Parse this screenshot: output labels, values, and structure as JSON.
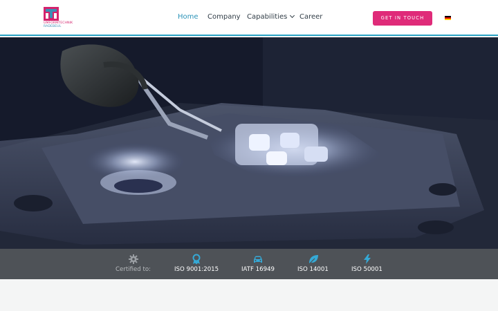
{
  "brand": {
    "name_line1": "UMFORMTECHNIK",
    "name_line2": "RADEBEUL",
    "primary_color": "#d4236d",
    "secondary_color": "#3b8fb5"
  },
  "nav": {
    "items": [
      {
        "label": "Home",
        "active": true
      },
      {
        "label": "Company",
        "active": false
      },
      {
        "label": "Capabilities",
        "active": false,
        "has_dropdown": true
      },
      {
        "label": "Career",
        "active": false
      }
    ],
    "cta_label": "GET IN TOUCH",
    "cta_color": "#df2b79",
    "active_color": "#2a93b8",
    "language_icon": "german-flag-icon"
  },
  "hero": {
    "icon": "hero-photo-forged-metal"
  },
  "certifications": {
    "intro_label": "Certified to:",
    "items": [
      {
        "label": "ISO 9001:2015",
        "icon": "award-ribbon-icon"
      },
      {
        "label": "IATF 16949",
        "icon": "car-icon"
      },
      {
        "label": "ISO 14001",
        "icon": "leaf-icon"
      },
      {
        "label": "ISO 50001",
        "icon": "lightning-bolt-icon"
      }
    ],
    "icon_color": "#35a9d6",
    "bar_color": "#4e5257"
  }
}
